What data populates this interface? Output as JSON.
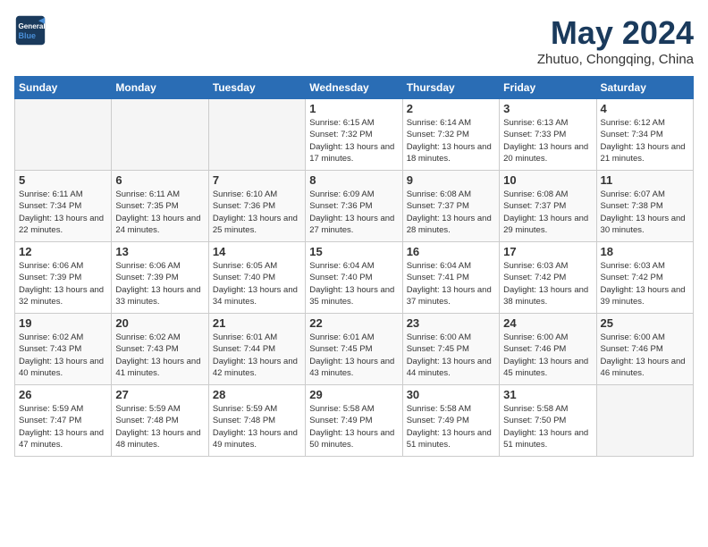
{
  "header": {
    "logo_line1": "General",
    "logo_line2": "Blue",
    "month": "May 2024",
    "location": "Zhutuo, Chongqing, China"
  },
  "weekdays": [
    "Sunday",
    "Monday",
    "Tuesday",
    "Wednesday",
    "Thursday",
    "Friday",
    "Saturday"
  ],
  "weeks": [
    [
      {
        "day": "",
        "empty": true
      },
      {
        "day": "",
        "empty": true
      },
      {
        "day": "",
        "empty": true
      },
      {
        "day": "1",
        "sunrise": "6:15 AM",
        "sunset": "7:32 PM",
        "daylight": "13 hours and 17 minutes."
      },
      {
        "day": "2",
        "sunrise": "6:14 AM",
        "sunset": "7:32 PM",
        "daylight": "13 hours and 18 minutes."
      },
      {
        "day": "3",
        "sunrise": "6:13 AM",
        "sunset": "7:33 PM",
        "daylight": "13 hours and 20 minutes."
      },
      {
        "day": "4",
        "sunrise": "6:12 AM",
        "sunset": "7:34 PM",
        "daylight": "13 hours and 21 minutes."
      }
    ],
    [
      {
        "day": "5",
        "sunrise": "6:11 AM",
        "sunset": "7:34 PM",
        "daylight": "13 hours and 22 minutes."
      },
      {
        "day": "6",
        "sunrise": "6:11 AM",
        "sunset": "7:35 PM",
        "daylight": "13 hours and 24 minutes."
      },
      {
        "day": "7",
        "sunrise": "6:10 AM",
        "sunset": "7:36 PM",
        "daylight": "13 hours and 25 minutes."
      },
      {
        "day": "8",
        "sunrise": "6:09 AM",
        "sunset": "7:36 PM",
        "daylight": "13 hours and 27 minutes."
      },
      {
        "day": "9",
        "sunrise": "6:08 AM",
        "sunset": "7:37 PM",
        "daylight": "13 hours and 28 minutes."
      },
      {
        "day": "10",
        "sunrise": "6:08 AM",
        "sunset": "7:37 PM",
        "daylight": "13 hours and 29 minutes."
      },
      {
        "day": "11",
        "sunrise": "6:07 AM",
        "sunset": "7:38 PM",
        "daylight": "13 hours and 30 minutes."
      }
    ],
    [
      {
        "day": "12",
        "sunrise": "6:06 AM",
        "sunset": "7:39 PM",
        "daylight": "13 hours and 32 minutes."
      },
      {
        "day": "13",
        "sunrise": "6:06 AM",
        "sunset": "7:39 PM",
        "daylight": "13 hours and 33 minutes."
      },
      {
        "day": "14",
        "sunrise": "6:05 AM",
        "sunset": "7:40 PM",
        "daylight": "13 hours and 34 minutes."
      },
      {
        "day": "15",
        "sunrise": "6:04 AM",
        "sunset": "7:40 PM",
        "daylight": "13 hours and 35 minutes."
      },
      {
        "day": "16",
        "sunrise": "6:04 AM",
        "sunset": "7:41 PM",
        "daylight": "13 hours and 37 minutes."
      },
      {
        "day": "17",
        "sunrise": "6:03 AM",
        "sunset": "7:42 PM",
        "daylight": "13 hours and 38 minutes."
      },
      {
        "day": "18",
        "sunrise": "6:03 AM",
        "sunset": "7:42 PM",
        "daylight": "13 hours and 39 minutes."
      }
    ],
    [
      {
        "day": "19",
        "sunrise": "6:02 AM",
        "sunset": "7:43 PM",
        "daylight": "13 hours and 40 minutes."
      },
      {
        "day": "20",
        "sunrise": "6:02 AM",
        "sunset": "7:43 PM",
        "daylight": "13 hours and 41 minutes."
      },
      {
        "day": "21",
        "sunrise": "6:01 AM",
        "sunset": "7:44 PM",
        "daylight": "13 hours and 42 minutes."
      },
      {
        "day": "22",
        "sunrise": "6:01 AM",
        "sunset": "7:45 PM",
        "daylight": "13 hours and 43 minutes."
      },
      {
        "day": "23",
        "sunrise": "6:00 AM",
        "sunset": "7:45 PM",
        "daylight": "13 hours and 44 minutes."
      },
      {
        "day": "24",
        "sunrise": "6:00 AM",
        "sunset": "7:46 PM",
        "daylight": "13 hours and 45 minutes."
      },
      {
        "day": "25",
        "sunrise": "6:00 AM",
        "sunset": "7:46 PM",
        "daylight": "13 hours and 46 minutes."
      }
    ],
    [
      {
        "day": "26",
        "sunrise": "5:59 AM",
        "sunset": "7:47 PM",
        "daylight": "13 hours and 47 minutes."
      },
      {
        "day": "27",
        "sunrise": "5:59 AM",
        "sunset": "7:48 PM",
        "daylight": "13 hours and 48 minutes."
      },
      {
        "day": "28",
        "sunrise": "5:59 AM",
        "sunset": "7:48 PM",
        "daylight": "13 hours and 49 minutes."
      },
      {
        "day": "29",
        "sunrise": "5:58 AM",
        "sunset": "7:49 PM",
        "daylight": "13 hours and 50 minutes."
      },
      {
        "day": "30",
        "sunrise": "5:58 AM",
        "sunset": "7:49 PM",
        "daylight": "13 hours and 51 minutes."
      },
      {
        "day": "31",
        "sunrise": "5:58 AM",
        "sunset": "7:50 PM",
        "daylight": "13 hours and 51 minutes."
      },
      {
        "day": "",
        "empty": true
      }
    ]
  ]
}
